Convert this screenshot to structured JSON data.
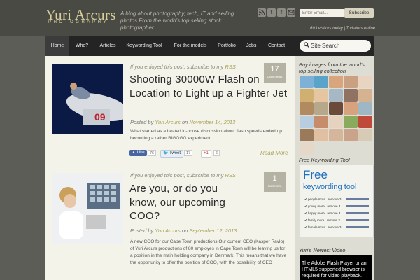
{
  "header": {
    "logo_name": "Yuri Arcurs",
    "logo_sub": "PHOTOGRAPHY",
    "tagline": "A blog about photography, tech, IT and selling photos From the world's top selling stock photographer",
    "email_placeholder": "Enter Email...",
    "subscribe_label": "Subscribe",
    "visitors": "693 visitors today | 7 visitors online",
    "social_icons": [
      "rss-icon",
      "twitter-icon",
      "facebook-icon",
      "email-icon"
    ]
  },
  "nav": {
    "items": [
      "Home",
      "Who?",
      "Articles",
      "Keywording Tool",
      "For the models",
      "Portfolio",
      "Jobs",
      "Contact"
    ],
    "active": "Home",
    "search_label": "Site Search"
  },
  "posts": [
    {
      "enjoy_prefix": "If you enjoyed this post, subscribe to my",
      "enjoy_link": "RSS",
      "title": "Shooting 30000W Flash on Location to Light up a Fighter Jet",
      "posted_by": "Posted by",
      "author": "Yuri Arcurs",
      "on": "on",
      "date": "November 14, 2013",
      "excerpt": "What started as a heated in-house discussion about flash speeds ended up becoming a rather BIGGGG experiment...",
      "comments": "17",
      "comments_label": "Comments",
      "like_label": "Like",
      "like_count": "76",
      "tweet_label": "Tweet",
      "tweet_count": "17",
      "gplus_label": "+1",
      "gplus_count": "6",
      "read_more": "Read More"
    },
    {
      "enjoy_prefix": "If you enjoyed this post, subscribe to my",
      "enjoy_link": "RSS",
      "title": "Are you, or do you know, our upcoming COO?",
      "posted_by": "Posted by",
      "author": "Yuri Arcurs",
      "on": "on",
      "date": "September 12, 2013",
      "excerpt": "A new COO for our Cape Town productions Our current CEO (Kasper Ravlo) of Yuri Arcurs productions of 80 employes in Cape Town will be leaving us for a position in the main holding company in Denmark. This means that we have the opportunity to offer the position of COO, with the possibility of CEO",
      "comments": "1",
      "comments_label": "Comment"
    }
  ],
  "sidebar": {
    "buy_heading": "Buy images from the world's top selling collection",
    "kw_heading": "Free Keywording Tool",
    "kw_free": "Free",
    "kw_tool": "keywording tool",
    "kw_rows": [
      "people more...remove 3",
      "young more...remove 3",
      "happy more...remove 3",
      "family more...remove 3",
      "female more...remove 3"
    ],
    "video_heading": "Yuri's Newest Video",
    "video_text": "The Adobe Flash Player or an HTML5 supported browser is required for video playback."
  },
  "colors": {
    "accent": "#a8a35a",
    "nav_bg": "#242424",
    "content_bg": "#f4f3ea",
    "sidebar_bg": "#deddd4"
  }
}
